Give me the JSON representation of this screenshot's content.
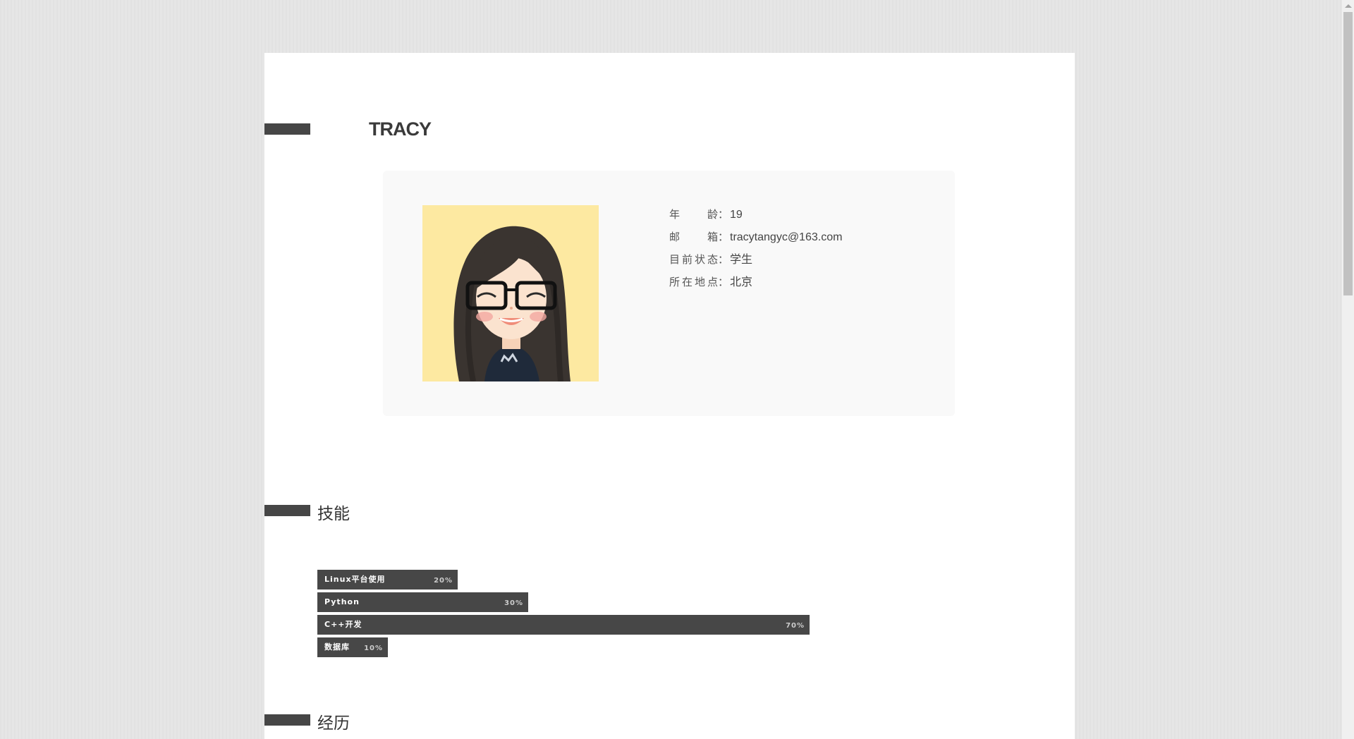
{
  "header": {
    "name": "TRACY"
  },
  "profile": {
    "avatar_alt": "cartoon-girl-avatar",
    "info": [
      {
        "label": "年龄",
        "colon": "：",
        "value": "19"
      },
      {
        "label": "邮箱",
        "colon": "：",
        "value": "tracytangyc@163.com"
      },
      {
        "label": "目前状态",
        "colon": "：",
        "value": "学生"
      },
      {
        "label": "所在地点",
        "colon": "：",
        "value": "北京"
      }
    ]
  },
  "sections": {
    "skills_title": "技能",
    "experience_title": "经历"
  },
  "skills": [
    {
      "label": "Linux平台使用",
      "percent_text": "20%",
      "level": 0.2
    },
    {
      "label": "Python",
      "percent_text": "30%",
      "level": 0.3
    },
    {
      "label": "C++开发",
      "percent_text": "70%",
      "level": 0.7
    },
    {
      "label": "数据库",
      "percent_text": "10%",
      "level": 0.1
    }
  ],
  "colors": {
    "marker": "#464646",
    "skill_bar": "#474747",
    "avatar_bg": "#fde9a1",
    "card_bg": "#f9f9f9"
  }
}
